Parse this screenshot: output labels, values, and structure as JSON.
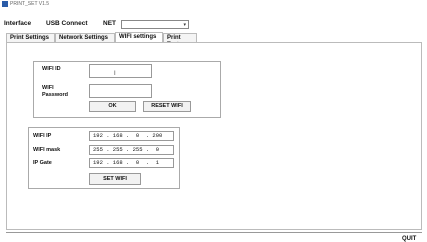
{
  "window": {
    "title": "PRINT_SET V1.5"
  },
  "toolbar": {
    "interface_label": "Interface",
    "usb_label": "USB Connect",
    "net_label": "NET",
    "net_select_value": ""
  },
  "tabs": [
    {
      "label": "Print Settings"
    },
    {
      "label": "Network Settings"
    },
    {
      "label": "WIFI settings",
      "active": true
    },
    {
      "label": "Print Test"
    }
  ],
  "wifi": {
    "id_label": "WIFI ID",
    "id_value": "",
    "password_label_1": "WIFI",
    "password_label_2": "Password",
    "password_value": "",
    "ok_label": "OK",
    "reset_label": "RESET WIFI"
  },
  "network": {
    "ip_label": "WIFI IP",
    "ip_value": "192 . 168 .  0  . 200",
    "mask_label": "WIFI mask",
    "mask_value": "255 . 255 . 255 .  0",
    "gate_label": "IP Gate",
    "gate_value": "192 . 168 .  0  .  1",
    "set_label": "SET WIFI"
  },
  "footer": {
    "quit_label": "QUIT"
  },
  "colors": {
    "highlight": "#e03030",
    "icon": "#2a5ca8"
  }
}
